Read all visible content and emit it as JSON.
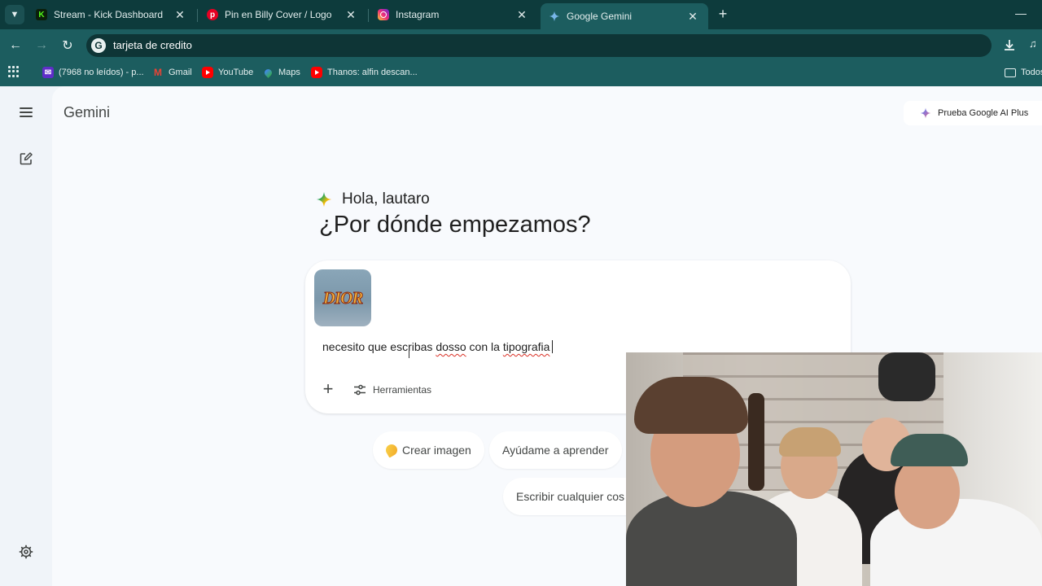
{
  "browser": {
    "tabs": [
      {
        "title": "Stream - Kick Dashboard",
        "icon": "kick-icon",
        "active": false
      },
      {
        "title": "Pin en Billy Cover / Logo",
        "icon": "pinterest-icon",
        "active": false
      },
      {
        "title": "Instagram",
        "icon": "instagram-icon",
        "active": false
      },
      {
        "title": "Google Gemini",
        "icon": "gemini-icon",
        "active": true
      }
    ],
    "new_tab_label": "+",
    "omnibox_text": "tarjeta de credito",
    "bookmarks": [
      {
        "label": "(7968 no leídos) - p...",
        "icon": "yahoo-mail-icon"
      },
      {
        "label": "Gmail",
        "icon": "gmail-icon"
      },
      {
        "label": "YouTube",
        "icon": "youtube-icon"
      },
      {
        "label": "Maps",
        "icon": "maps-icon"
      },
      {
        "label": "Thanos: alfin descan...",
        "icon": "youtube-icon"
      }
    ],
    "bookmarks_folder": "Todos",
    "colors": {
      "frame": "#0d3b3c",
      "toolbar": "#1c5d5f",
      "omnibox": "#0e3536"
    }
  },
  "gemini": {
    "app_title": "Gemini",
    "upgrade_label": "Prueba Google AI Plus",
    "greeting": "Hola, lautaro",
    "headline": "¿Por dónde empezamos?",
    "attachment": {
      "logo_text": "DIOR"
    },
    "prompt": {
      "part1": "necesito que escribas ",
      "word1": "dosso",
      "part2": " con la ",
      "word2": "tipografia"
    },
    "tools_label": "Herramientas",
    "chips": [
      "Crear imagen",
      "Ayúdame a aprender",
      "Escribir cualquier cos"
    ]
  }
}
